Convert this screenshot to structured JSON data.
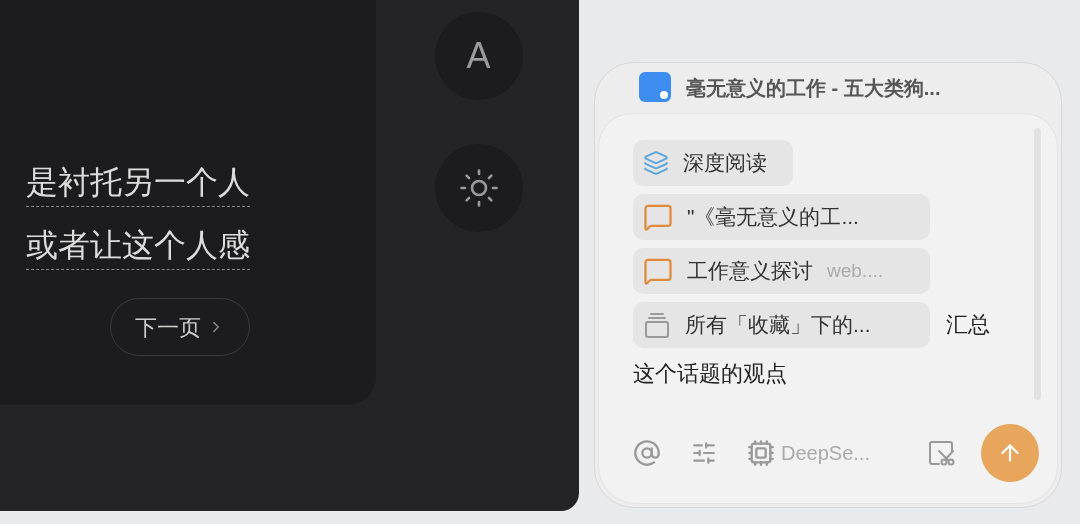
{
  "reader": {
    "lines": [
      "是衬托另一个人",
      "或者让这个人感"
    ],
    "next_button": "下一页",
    "font_button": "A"
  },
  "chat": {
    "title": "毫无意义的工作 - 五大类狗...",
    "chips": [
      {
        "kind": "layers",
        "label": "深度阅读"
      },
      {
        "kind": "quote",
        "label": "\"《毫无意义的工..."
      },
      {
        "kind": "quote",
        "label": "工作意义探讨",
        "note": "web...."
      },
      {
        "kind": "collection",
        "label": "所有「收藏」下的..."
      }
    ],
    "text": [
      "汇总",
      "这个话题的观点"
    ],
    "model": "DeepSe..."
  }
}
